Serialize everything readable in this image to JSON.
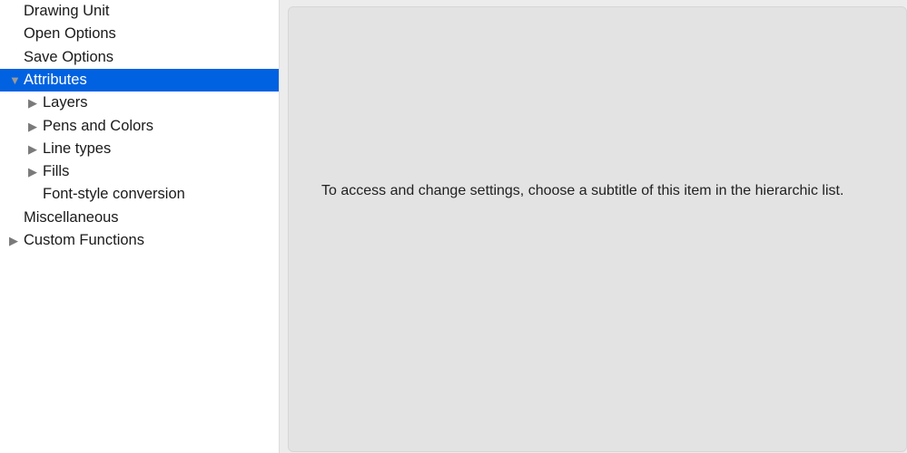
{
  "tree": [
    {
      "label": "Drawing Unit",
      "level": 1,
      "arrow": "none"
    },
    {
      "label": "Open Options",
      "level": 1,
      "arrow": "none"
    },
    {
      "label": "Save Options",
      "level": 1,
      "arrow": "none"
    },
    {
      "label": "Attributes",
      "level": 0,
      "arrow": "expanded",
      "selected": true
    },
    {
      "label": "Layers",
      "level": 2,
      "arrow": "collapsed"
    },
    {
      "label": "Pens and Colors",
      "level": 2,
      "arrow": "collapsed"
    },
    {
      "label": "Line types",
      "level": 2,
      "arrow": "collapsed"
    },
    {
      "label": "Fills",
      "level": 2,
      "arrow": "collapsed"
    },
    {
      "label": "Font-style conversion",
      "level": 2,
      "arrow": "none"
    },
    {
      "label": "Miscellaneous",
      "level": 1,
      "arrow": "none"
    },
    {
      "label": "Custom Functions",
      "level": 0,
      "arrow": "collapsed"
    }
  ],
  "panel": {
    "message": "To access and change settings, choose a subtitle of this item in the hierarchic list."
  },
  "colors": {
    "selection": "#0062e1"
  }
}
